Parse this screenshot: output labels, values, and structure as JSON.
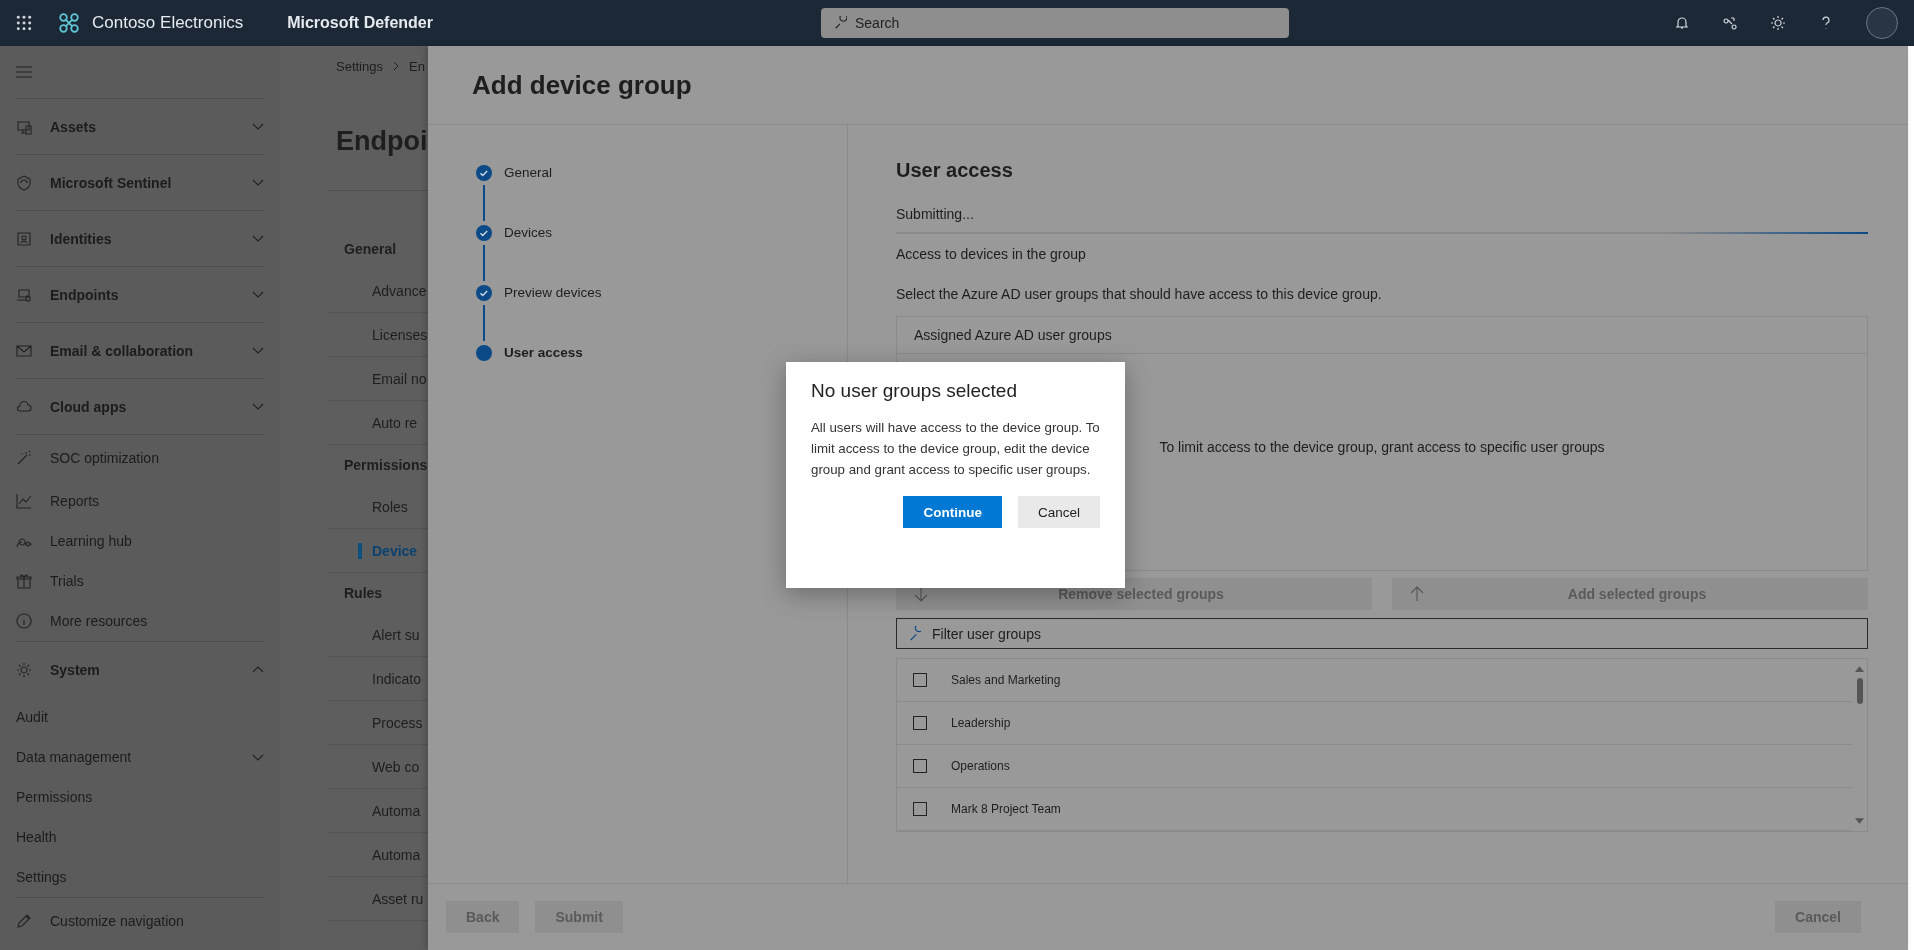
{
  "top_bar": {
    "brand": "Contoso Electronics",
    "product": "Microsoft Defender",
    "search": {
      "placeholder": "Search"
    }
  },
  "nav": [
    {
      "label": "Assets",
      "kind": "group",
      "expanded": false
    },
    {
      "label": "Microsoft Sentinel",
      "kind": "group",
      "expanded": false
    },
    {
      "label": "Identities",
      "kind": "group",
      "expanded": false
    },
    {
      "label": "Endpoints",
      "kind": "group",
      "expanded": false
    },
    {
      "label": "Email & collaboration",
      "kind": "group",
      "expanded": false
    },
    {
      "label": "Cloud apps",
      "kind": "group",
      "expanded": false
    },
    {
      "label": "SOC optimization",
      "kind": "link"
    },
    {
      "label": "Reports",
      "kind": "link"
    },
    {
      "label": "Learning hub",
      "kind": "link"
    },
    {
      "label": "Trials",
      "kind": "link"
    },
    {
      "label": "More resources",
      "kind": "link"
    },
    {
      "label": "System",
      "kind": "group",
      "expanded": true
    },
    {
      "label": "Audit",
      "kind": "sub"
    },
    {
      "label": "Data management",
      "kind": "sub",
      "expanded": false
    },
    {
      "label": "Permissions",
      "kind": "sub"
    },
    {
      "label": "Health",
      "kind": "sub"
    },
    {
      "label": "Settings",
      "kind": "sub"
    },
    {
      "label": "Customize navigation",
      "kind": "link"
    }
  ],
  "settings_page": {
    "breadcrumb": [
      "Settings",
      "En"
    ],
    "title": "Endpoi",
    "sections": [
      {
        "label": "General",
        "kind": "heading"
      },
      {
        "label": "Advance",
        "kind": "item",
        "selected": false
      },
      {
        "label": "Licenses",
        "kind": "item",
        "selected": false
      },
      {
        "label": "Email no",
        "kind": "item",
        "selected": false
      },
      {
        "label": "Auto re",
        "kind": "item",
        "selected": false
      },
      {
        "label": "Permissions",
        "kind": "heading"
      },
      {
        "label": "Roles",
        "kind": "item",
        "selected": false
      },
      {
        "label": "Device",
        "kind": "item",
        "selected": true
      },
      {
        "label": "Rules",
        "kind": "heading"
      },
      {
        "label": "Alert su",
        "kind": "item",
        "selected": false
      },
      {
        "label": "Indicato",
        "kind": "item",
        "selected": false
      },
      {
        "label": "Process",
        "kind": "item",
        "selected": false
      },
      {
        "label": "Web co",
        "kind": "item",
        "selected": false
      },
      {
        "label": "Automa",
        "kind": "item",
        "selected": false
      },
      {
        "label": "Automa",
        "kind": "item",
        "selected": false
      },
      {
        "label": "Asset ru",
        "kind": "item",
        "selected": false
      }
    ]
  },
  "panel": {
    "title": "Add device group",
    "steps": [
      {
        "label": "General",
        "completed": true,
        "selected": false
      },
      {
        "label": "Devices",
        "completed": true,
        "selected": false
      },
      {
        "label": "Preview devices",
        "completed": true,
        "selected": false
      },
      {
        "label": "User access",
        "completed": false,
        "selected": true
      }
    ],
    "section_title": "User access",
    "status": "Submitting...",
    "indeterminate": true,
    "subtitle": "Access to devices in the group",
    "description": "Select the Azure AD user groups that should have access to this device group.",
    "assigned": {
      "header": "Assigned Azure AD user groups",
      "empty_message": "To limit access to the device group, grant access to specific user groups"
    },
    "actions": [
      {
        "label": "Remove selected groups",
        "kind": "down",
        "disabled": true
      },
      {
        "label": "Add selected groups",
        "kind": "up",
        "disabled": true
      }
    ],
    "filter": {
      "placeholder": "Filter user groups"
    },
    "groups": [
      {
        "name": "Sales and Marketing",
        "checked": false
      },
      {
        "name": "Leadership",
        "checked": false
      },
      {
        "name": "Operations",
        "checked": false
      },
      {
        "name": "Mark 8 Project Team",
        "checked": false
      }
    ],
    "footer": {
      "back": "Back",
      "submit": "Submit",
      "cancel": "Cancel",
      "disabled": true
    }
  },
  "dialog": {
    "title": "No user groups selected",
    "body": "All users will have access to the device group. To limit access to the device group, edit the device group and grant access to specific user groups.",
    "buttons": [
      {
        "label": "Continue",
        "kind": "primary"
      },
      {
        "label": "Cancel",
        "kind": "secondary"
      }
    ]
  }
}
